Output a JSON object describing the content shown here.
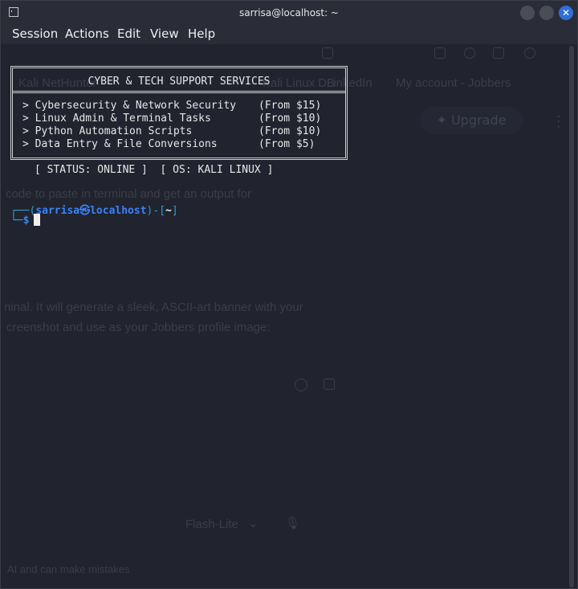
{
  "window": {
    "title": "sarrisa@localhost: ~"
  },
  "menu": [
    "Session",
    "Actions",
    "Edit",
    "View",
    "Help"
  ],
  "background": {
    "tabs": [
      "Kali NetHunter",
      "Kali Linux DB",
      "LinkedIn",
      "My account - Jobbers"
    ],
    "upgrade": "Upgrade",
    "line1": "code to paste in terminal and get an output for",
    "line2": "ninal. It will generate a sleek, ASCII-art banner with your",
    "line3": "creenshot and use as your Jobbers profile image:",
    "model": "Flash-Lite",
    "disclaimer": "AI and can make mistakes"
  },
  "terminal": {
    "banner_title": "CYBER & TECH SUPPORT SERVICES",
    "services": [
      {
        "name": "> Cybersecurity & Network Security",
        "price": "(From $15)"
      },
      {
        "name": "> Linux Admin & Terminal Tasks",
        "price": "(From $10)"
      },
      {
        "name": "> Python Automation Scripts",
        "price": "(From $10)"
      },
      {
        "name": "> Data Entry & File Conversions",
        "price": "(From $5)"
      }
    ],
    "status_line": "[ STATUS: ONLINE ]  [ OS: KALI LINUX ]",
    "prompt": {
      "open": "┌──(",
      "user_host": "sarrisa㉿localhost",
      "mid": ")-[",
      "cwd": "~",
      "close": "]",
      "corner": "└─",
      "symbol": "$"
    }
  },
  "colors": {
    "accent": "#2f6fd6",
    "prompt_blue": "#3b82f6",
    "bg": "#21232e"
  }
}
